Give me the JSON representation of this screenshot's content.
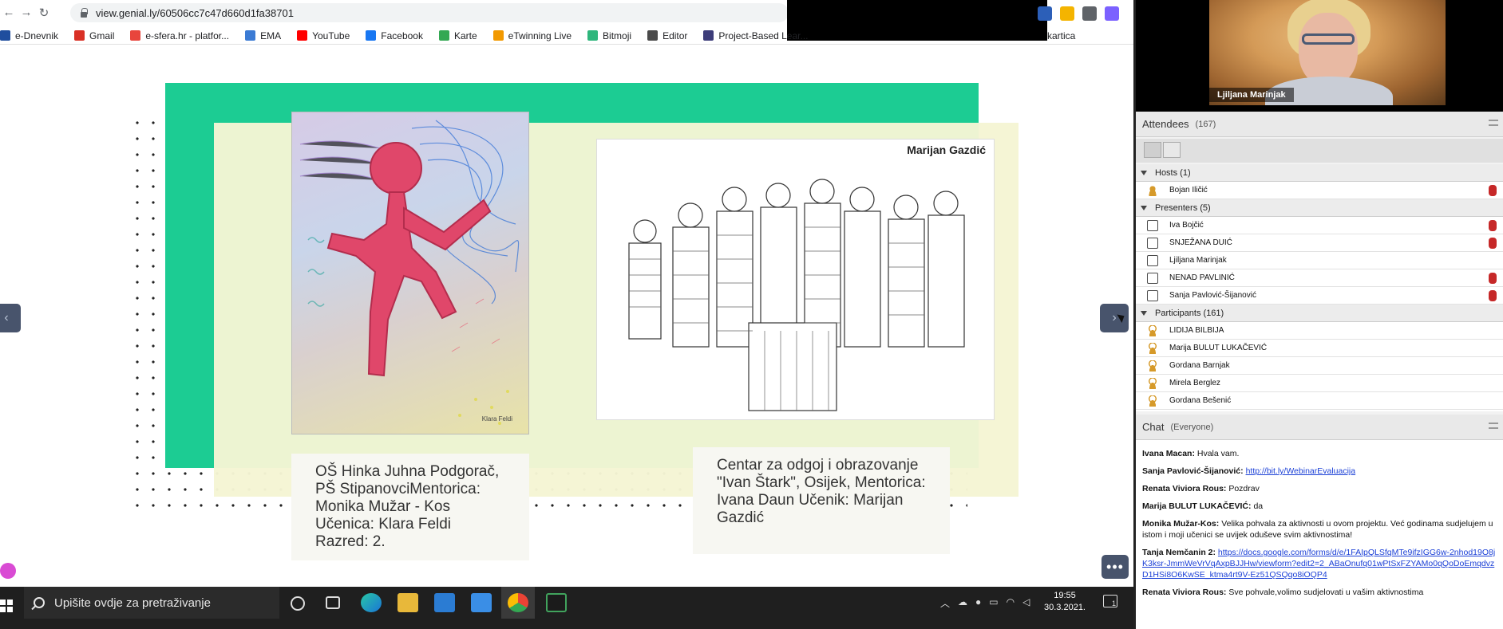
{
  "browser": {
    "url": "view.genial.ly/60506cc7c47d660d1fa38701",
    "bookmarks": [
      {
        "label": "e-Dnevnik",
        "icon": "edn-icon",
        "color": "#1f4e9e"
      },
      {
        "label": "Gmail",
        "icon": "gmail-icon",
        "color": "#d93025"
      },
      {
        "label": "e-sfera.hr - platfor...",
        "icon": "esfera-icon",
        "color": "#e8453c"
      },
      {
        "label": "EMA",
        "icon": "ema-icon",
        "color": "#3b7bd4"
      },
      {
        "label": "YouTube",
        "icon": "youtube-icon",
        "color": "#ff0000"
      },
      {
        "label": "Facebook",
        "icon": "facebook-icon",
        "color": "#1877f2"
      },
      {
        "label": "Karte",
        "icon": "maps-icon",
        "color": "#34a853"
      },
      {
        "label": "eTwinning Live",
        "icon": "etwinning-icon",
        "color": "#f29900"
      },
      {
        "label": "Bitmoji",
        "icon": "bitmoji-icon",
        "color": "#2fb67c"
      },
      {
        "label": "Editor",
        "icon": "editor-icon",
        "color": "#4a4a4a"
      },
      {
        "label": "Project-Based Lear...",
        "icon": "pbl-icon",
        "color": "#3d3d7a"
      }
    ],
    "bookmark_overflow": "kartica"
  },
  "slide": {
    "drawing1_signature": "Klara Feldi",
    "drawing2_title": "Marijan Gazdić",
    "caption1": "OŠ Hinka Juhna Podgorač, PŠ StipanovciMentorica: Monika Mužar - Kos Učenica: Klara Feldi Razred: 2.",
    "caption2": "Centar za odgoj i obrazovanje \"Ivan Štark\", Osijek, Mentorica: Ivana Daun Učenik: Marijan Gazdić",
    "nav_prev": "‹",
    "nav_next": "›",
    "more": "•••"
  },
  "taskbar": {
    "search_placeholder": "Upišite ovdje za pretraživanje",
    "time": "19:55",
    "date": "30.3.2021.",
    "notifications": "1"
  },
  "webex": {
    "video_name": "Ljiljana Marinjak",
    "attendees_title": "Attendees",
    "attendees_count": "(167)",
    "groups": [
      {
        "label": "Hosts (1)",
        "rows": [
          {
            "name": "Bojan Iličić",
            "role": "host",
            "muted": true
          }
        ]
      },
      {
        "label": "Presenters (5)",
        "rows": [
          {
            "name": "Iva Bojčić",
            "role": "pres",
            "muted": true
          },
          {
            "name": "SNJEŽANA DUIĆ",
            "role": "pres",
            "muted": true
          },
          {
            "name": "Ljiljana Marinjak",
            "role": "pres",
            "muted": false
          },
          {
            "name": "NENAD PAVLINIĆ",
            "role": "pres",
            "muted": true
          },
          {
            "name": "Sanja Pavlović-Šijanović",
            "role": "pres",
            "muted": true
          }
        ]
      },
      {
        "label": "Participants (161)",
        "rows": [
          {
            "name": "LIDIJA BILBIJA",
            "role": "part",
            "muted": false
          },
          {
            "name": "Marija BULUT LUKAČEVIĆ",
            "role": "part",
            "muted": false
          },
          {
            "name": "Gordana Barnjak",
            "role": "part",
            "muted": false
          },
          {
            "name": "Mirela Berglez",
            "role": "part",
            "muted": false
          },
          {
            "name": "Gordana Bešenić",
            "role": "part",
            "muted": false
          }
        ]
      }
    ],
    "chat_title": "Chat",
    "chat_scope": "(Everyone)",
    "messages": [
      {
        "from": "Ivana Macan:",
        "text": "Hvala vam.",
        "link": ""
      },
      {
        "from": "Sanja Pavlović-Šijanović:",
        "text": "",
        "link": "http://bit.ly/WebinarEvaluacija"
      },
      {
        "from": "Renata Viviora Rous:",
        "text": "Pozdrav",
        "link": ""
      },
      {
        "from": "Marija BULUT LUKAČEVIĆ:",
        "text": "da",
        "link": ""
      },
      {
        "from": "Monika Mužar-Kos:",
        "text": "Velika pohvala za aktivnosti u ovom projektu. Već godinama sudjelujem u istom i moji učenici se uvijek oduševe svim aktivnostima!",
        "link": ""
      },
      {
        "from": "Tanja Nemčanin 2:",
        "text": "",
        "link": "https://docs.google.com/forms/d/e/1FAIpQLSfqMTe9ifzIGG6w-2nhod19O8jK3ksr-JmmWeVrVqAxpBJJHw/viewform?edit2=2_ABaOnufq01wPtSxFZYAMo0qQoDoEmqdvzD1HSi8O6KwSE_ktma4rt9V-Ez51QSQqo8iOQP4"
      },
      {
        "from": "Renata Viviora Rous:",
        "text": "Sve pohvale,volimo sudjelovati u vašim aktivnostima",
        "link": ""
      }
    ]
  }
}
